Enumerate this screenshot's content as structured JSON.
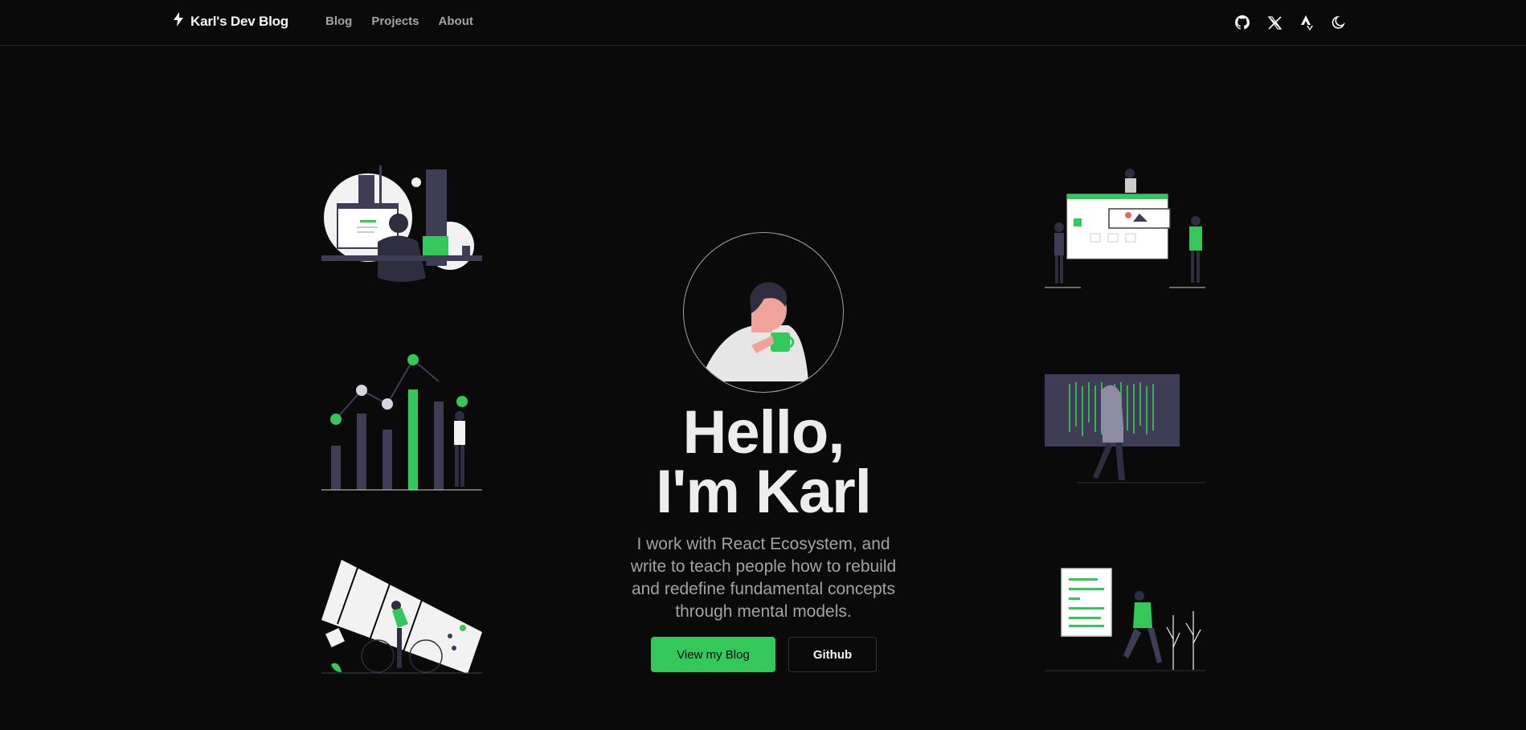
{
  "header": {
    "brand": "Karl's Dev Blog",
    "brand_icon": "lightning-bolt-icon",
    "nav": [
      {
        "label": "Blog"
      },
      {
        "label": "Projects"
      },
      {
        "label": "About"
      }
    ],
    "icons": [
      "github-icon",
      "x-twitter-icon",
      "strava-icon",
      "moon-theme-icon"
    ]
  },
  "hero": {
    "title_line1": "Hello,",
    "title_line2": "I'm Karl",
    "description": "I work with React Ecosystem, and write to teach people how to rebuild and redefine fundamental concepts through mental models.",
    "primary_button": "View my Blog",
    "secondary_button": "Github"
  },
  "colors": {
    "background": "#0a0a0a",
    "accent": "#34c759",
    "text": "#ededed",
    "muted": "#a3a3a3"
  }
}
